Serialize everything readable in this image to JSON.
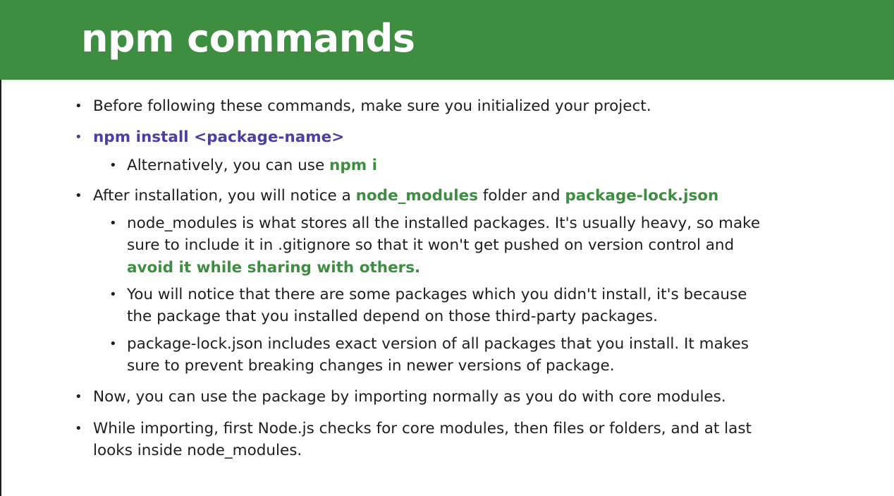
{
  "title": "npm commands",
  "bullets": {
    "b1": {
      "text": "Before following these commands, make sure you initialized your project."
    },
    "b2": {
      "text": "npm install <package-name>"
    },
    "b2_1": {
      "text": "Alternatively, you can use ",
      "kw": "npm i"
    },
    "b3": {
      "text_a": "After installation, you will notice a ",
      "kw_a": "node_modules",
      "text_b": " folder and ",
      "kw_b": "package-lock.json"
    },
    "b3_1": {
      "line1": "node_modules is what stores all the installed packages. It's usually heavy, so make",
      "line2": "sure to include it in .gitignore so that it won't get pushed on version control and",
      "line3_kw": "avoid it while sharing with others."
    },
    "b3_2": {
      "line1": "You will notice that there are some packages which you didn't install, it's because",
      "line2": "the package that you installed depend on those third-party packages."
    },
    "b3_3": {
      "line1": "package-lock.json includes exact version of all packages that you install. It makes",
      "line2": "sure to prevent breaking changes in newer versions of package."
    },
    "b4": {
      "text": "Now, you can use the package by importing normally as you do with core modules."
    },
    "b5": {
      "line1": "While importing, first Node.js checks for core modules, then files or folders, and at last",
      "line2": "looks inside node_modules."
    }
  },
  "colors": {
    "header": "#3e8e41",
    "keyword_green": "#3e8e41",
    "keyword_purple": "#4b3fa3",
    "text": "#1e1e1e"
  }
}
